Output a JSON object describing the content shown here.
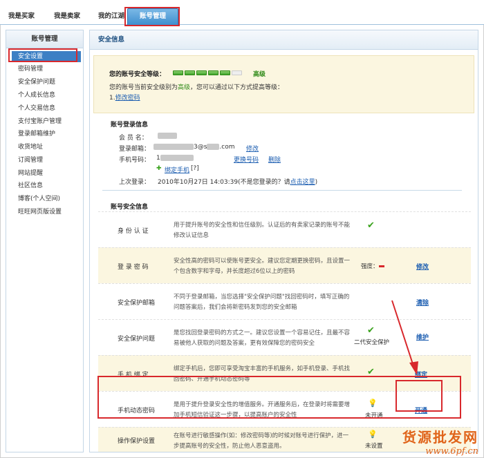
{
  "tabs": [
    {
      "label": "我是买家"
    },
    {
      "label": "我是卖家"
    },
    {
      "label": "我的江湖"
    },
    {
      "label": "账号管理"
    }
  ],
  "sidebar": {
    "title": "账号管理",
    "items": [
      {
        "label": "安全设置"
      },
      {
        "label": "密码管理"
      },
      {
        "label": "安全保护问题"
      },
      {
        "label": "个人成长信息"
      },
      {
        "label": "个人交易信息"
      },
      {
        "label": "支付宝账户管理"
      },
      {
        "label": "登录邮箱维护"
      },
      {
        "label": "收货地址"
      },
      {
        "label": "订阅管理"
      },
      {
        "label": "网站提醒"
      },
      {
        "label": "社区信息"
      },
      {
        "label": "博客(个人空间)"
      },
      {
        "label": "旺旺网页版设置"
      }
    ]
  },
  "main": {
    "title": "安全信息",
    "level": {
      "label": "您的账号安全等级：",
      "value": "高级",
      "filled": 5,
      "total": 6,
      "line1_pre": "您的账号当前安全级别为",
      "line1_level": "高级",
      "line1_post": "，您可以通过以下方式提高等级：",
      "tip_num": "1.",
      "tip_link": "修改密码"
    },
    "login": {
      "title": "账号登录信息",
      "member_label": "会 员 名：",
      "email_label": "登录邮箱：",
      "email_tail": "3@s",
      "email_domain": ".com",
      "email_action": "修改",
      "phone_label": "手机号码：",
      "phone_prefix": "1",
      "phone_change": "更换号码",
      "phone_delete": "删除",
      "bind_label": "绑定手机",
      "bind_help": "[?]",
      "last_label": "上次登录：",
      "last_value": "2010年10月27日 14:03:39(不是您登录的？请",
      "last_link": "点击这里",
      "last_end": ")"
    },
    "security": {
      "title": "账号安全信息",
      "rows": [
        {
          "name": "身 份 认 证",
          "desc": "用于提升账号的安全性和信任级别。认证后的有卖家记录的账号不能修改认证信息",
          "status": "",
          "action": ""
        },
        {
          "name": "登 录 密 码",
          "desc": "安全性高的密码可以使账号更安全。建议您定期更换密码，且设置一个包含数字和字母，并长度超过6位以上的密码",
          "status": "强度：",
          "action": "修改"
        },
        {
          "name": "安全保护邮箱",
          "desc": "不同于登录邮箱，当您选择\"安全保护问题\"找回密码时，填写正确的问题答案后，我们会将新密码发到您的安全邮箱",
          "status": "",
          "action": "清除"
        },
        {
          "name": "安全保护问题",
          "desc": "是您找回登录密码的方式之一。建议您设置一个容易记住，且最不容易被他人获取的问题及答案，更有效保障您的密码安全",
          "status": "二代安全保护",
          "action": "维护"
        },
        {
          "name": "手 机 绑 定",
          "desc": "绑定手机后，您即可享受淘宝丰富的手机服务，如手机登录、手机找回密码、开通手机动态密码等",
          "status": "",
          "action": "绑定"
        },
        {
          "name": "手机动态密码",
          "desc": "是用于提升登录安全性的增值服务。开通服务后，在登录时将需要增加手机短信验证这一步骤，以提高账户的安全性",
          "status": "未开通",
          "action": "开通"
        },
        {
          "name": "操作保护设置",
          "desc": "在账号进行敏感操作(如：修改密码等)的时候对账号进行保护，进一步提高账号的安全性，防止他人恶意盗用。",
          "status": "未设置",
          "action": ""
        }
      ]
    }
  },
  "watermark": {
    "line1": "货源批发网",
    "line2": "www.6pf.cn"
  },
  "colors": {
    "accent": "#3d7fc4",
    "highlight": "#d8282c",
    "green": "#39a21c",
    "panel_yellow": "#fbf6e0"
  }
}
